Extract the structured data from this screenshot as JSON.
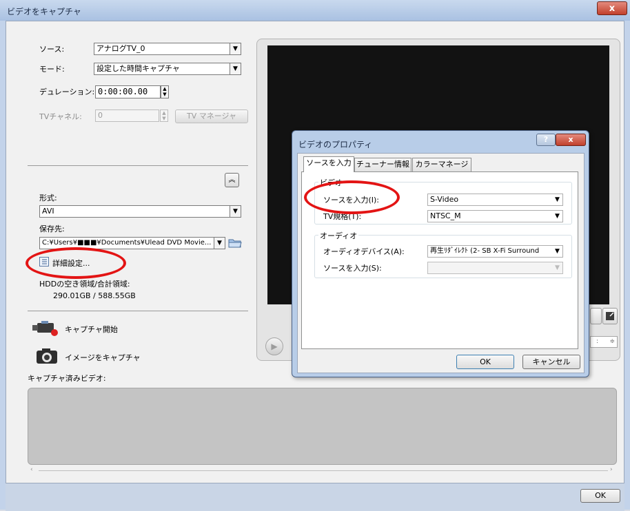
{
  "window": {
    "title": "ビデオをキャプチャ",
    "close_glyph": "x"
  },
  "capture": {
    "source_label": "ソース:",
    "source_value": "アナログTV_0",
    "mode_label": "モード:",
    "mode_value": "設定した時間キャプチャ",
    "duration_label": "デュレーション:",
    "duration_value": "0:00:00.00",
    "tv_channel_label": "TVチャネル:",
    "tv_channel_value": "0",
    "tv_manager_label": "TV マネージャ"
  },
  "output": {
    "format_label": "形式:",
    "format_value": "AVI",
    "save_to_label": "保存先:",
    "save_to_value": "C:¥Users¥■■■¥Documents¥Ulead DVD Movie...",
    "advanced_label": "詳細設定...",
    "hdd_label": "HDDの空き領域/合計領域:",
    "hdd_value": "290.01GB / 588.55GB"
  },
  "actions": {
    "start_capture": "キャプチャ開始",
    "capture_image": "イメージをキャプチャ"
  },
  "captured": {
    "label": "キャプチャ済みビデオ:"
  },
  "footer": {
    "ok": "OK"
  },
  "dialog": {
    "title": "ビデオのプロパティ",
    "help_glyph": "?",
    "close_glyph": "x",
    "tabs": [
      {
        "label": "ソースを入力"
      },
      {
        "label": "チューナー情報"
      },
      {
        "label": "カラーマネージャ"
      }
    ],
    "video_group": "ビデオ",
    "input_source_label": "ソースを入力(I):",
    "input_source_value": "S-Video",
    "tv_standard_label": "TV規格(T):",
    "tv_standard_value": "NTSC_M",
    "audio_group": "オーディオ",
    "audio_device_label": "オーディオデバイス(A):",
    "audio_device_value": "再生ﾘﾀﾞｲﾚｸﾄ (2- SB X-Fi Surround",
    "audio_input_label": "ソースを入力(S):",
    "audio_input_value": "",
    "ok": "OK",
    "cancel": "キャンセル"
  },
  "colors": {
    "highlight_red": "#e31414",
    "dialog_frame": "#b8cde8",
    "preview_screen": "#121212"
  }
}
